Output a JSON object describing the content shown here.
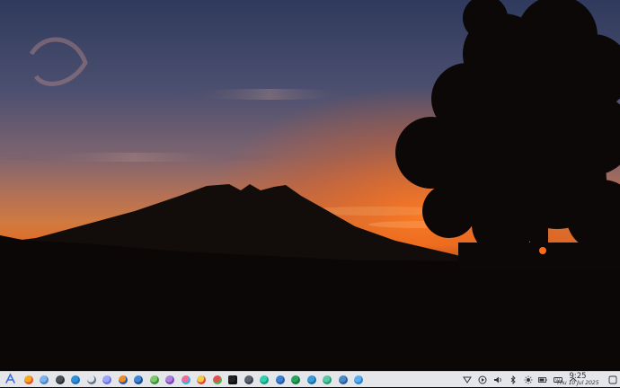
{
  "wallpaper": {
    "description_colors": {
      "sky_top": "#3a4363",
      "sky_mid": "#6d5c6e",
      "sky_glow": "#e0662a",
      "ground": "#0b0706"
    }
  },
  "taskbar": {
    "launcher_icon": "app-launcher-icon",
    "apps": [
      {
        "name": "firefox-icon",
        "color": "#f6a623",
        "ring": "#e0582b"
      },
      {
        "name": "files-icon",
        "color": "#7fb3e8",
        "ring": "#4a86c8"
      },
      {
        "name": "terminal-icon",
        "color": "#4a5058",
        "ring": "#2d3238"
      },
      {
        "name": "mail-icon",
        "color": "#2f8fd8",
        "ring": "#1e6fb0"
      },
      {
        "name": "text-editor-icon",
        "color": "#dfe3ea",
        "ring": "#6a7482"
      },
      {
        "name": "image-viewer-icon",
        "color": "#9aa6ff",
        "ring": "#6b75e0"
      },
      {
        "name": "blender-icon",
        "color": "#f08a24",
        "ring": "#2b5b9a"
      },
      {
        "name": "system-monitor-icon",
        "color": "#3f86d8",
        "ring": "#1b4f8f"
      },
      {
        "name": "media-player-icon",
        "color": "#7cc96a",
        "ring": "#3e8f3a"
      },
      {
        "name": "graphics-editor-icon",
        "color": "#b080e0",
        "ring": "#7a4bb8"
      },
      {
        "name": "photo-app-icon",
        "color": "#f06a9a",
        "ring": "#3ab0e0"
      },
      {
        "name": "chromium-icon",
        "color": "#f2c94c",
        "ring": "#e04a3a"
      },
      {
        "name": "color-picker-icon",
        "color": "#e05050",
        "ring": "#50b050"
      },
      {
        "name": "spreadsheet-icon",
        "color": "#222222",
        "ring": "#111111"
      },
      {
        "name": "settings-icon",
        "color": "#5a6270",
        "ring": "#3a414c"
      },
      {
        "name": "chat-icon",
        "color": "#2fd0b0",
        "ring": "#1a9c84"
      },
      {
        "name": "music-icon",
        "color": "#3a7fd0",
        "ring": "#2a5fa8"
      },
      {
        "name": "store-icon",
        "color": "#26a65b",
        "ring": "#167a40"
      },
      {
        "name": "maps-icon",
        "color": "#3b9ad8",
        "ring": "#2070a8"
      },
      {
        "name": "notes-icon",
        "color": "#5ac8a0",
        "ring": "#2f9a78"
      },
      {
        "name": "network-app-icon",
        "color": "#4a88c8",
        "ring": "#2c5e98"
      },
      {
        "name": "weather-icon",
        "color": "#5aaef0",
        "ring": "#2f86d0"
      }
    ],
    "tray": [
      "network-icon",
      "media-play-icon",
      "volume-icon",
      "bluetooth-icon",
      "brightness-icon",
      "battery-icon",
      "keyboard-icon",
      "expand-tray-icon"
    ],
    "clock": {
      "time": "9:25",
      "date": "Thu 10 Jul 2025"
    }
  }
}
